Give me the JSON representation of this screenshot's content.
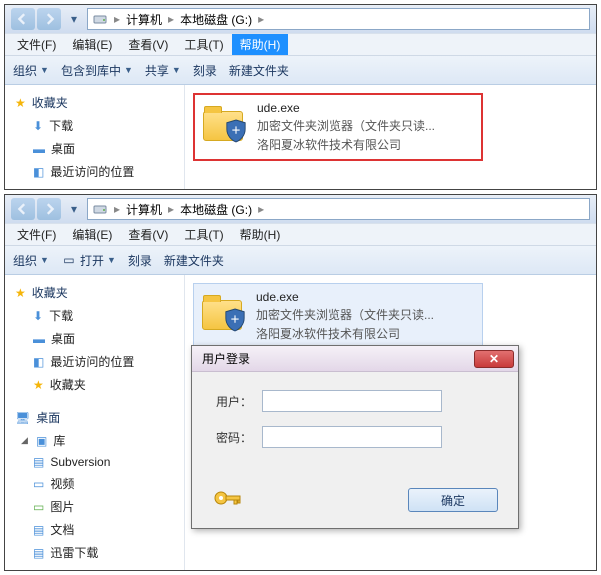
{
  "win1": {
    "breadcrumb": {
      "part1": "计算机",
      "part2": "本地磁盘 (G:)"
    },
    "menu": {
      "file": "文件(F)",
      "edit": "编辑(E)",
      "view": "查看(V)",
      "tools": "工具(T)",
      "help": "帮助(H)"
    },
    "toolbar": {
      "org": "组织",
      "include": "包含到库中",
      "share": "共享",
      "burn": "刻录",
      "newfolder": "新建文件夹"
    },
    "sidebar": {
      "fav": "收藏夹",
      "downloads": "下载",
      "desktop": "桌面",
      "recent": "最近访问的位置"
    },
    "file": {
      "name": "ude.exe",
      "line2": "加密文件夹浏览器（文件夹只读...",
      "line3": "洛阳夏冰软件技术有限公司"
    }
  },
  "win2": {
    "breadcrumb": {
      "part1": "计算机",
      "part2": "本地磁盘 (G:)"
    },
    "menu": {
      "file": "文件(F)",
      "edit": "编辑(E)",
      "view": "查看(V)",
      "tools": "工具(T)",
      "help": "帮助(H)"
    },
    "toolbar": {
      "org": "组织",
      "open": "打开",
      "burn": "刻录",
      "newfolder": "新建文件夹"
    },
    "sidebar": {
      "fav": "收藏夹",
      "downloads": "下载",
      "desktop": "桌面",
      "recent": "最近访问的位置",
      "fav2": "收藏夹",
      "desktop2": "桌面",
      "lib": "库",
      "subv": "Subversion",
      "video": "视频",
      "pic": "图片",
      "doc": "文档",
      "xunlei": "迅雷下载"
    },
    "file": {
      "name": "ude.exe",
      "line2": "加密文件夹浏览器（文件夹只读...",
      "line3": "洛阳夏冰软件技术有限公司"
    },
    "dialog": {
      "title": "用户登录",
      "user": "用户：",
      "pass": "密码：",
      "ok": "确定"
    }
  }
}
